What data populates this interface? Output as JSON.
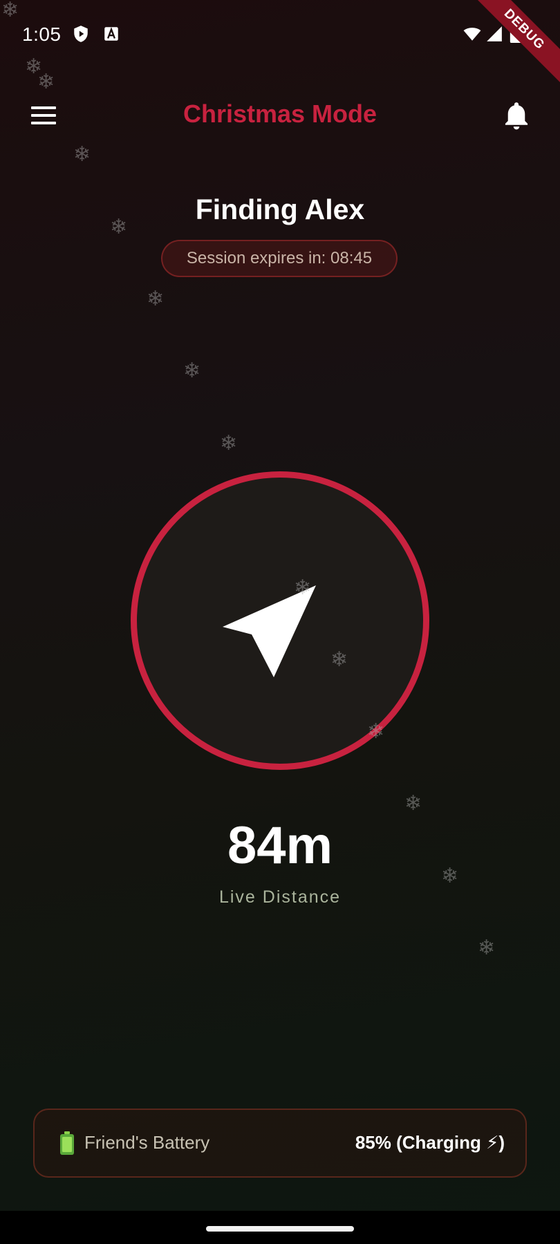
{
  "status_bar": {
    "time": "1:05",
    "left_icons": [
      "shield-play-icon",
      "font-a-icon"
    ],
    "right_icons": [
      "wifi-icon",
      "cell-signal-icon",
      "battery-icon"
    ]
  },
  "debug_banner": "DEBUG",
  "app_bar": {
    "title": "Christmas Mode",
    "left_icon": "menu-icon",
    "right_icon": "bell-icon"
  },
  "header": {
    "title": "Finding Alex",
    "session_text": "Session expires in: 08:45"
  },
  "compass": {
    "icon": "navigation-arrow-icon"
  },
  "distance": {
    "value": "84m",
    "label": "Live Distance"
  },
  "battery": {
    "icon": "battery-full-icon",
    "label": "Friend's Battery",
    "value": "85% (Charging ⚡)"
  },
  "colors": {
    "accent": "#c8223f",
    "background_top": "#1c0c0d",
    "background_bottom": "#0d1710",
    "text_primary": "#ffffff",
    "text_muted": "#aab49c"
  },
  "decoration": {
    "snowflake_glyph": "❄"
  }
}
